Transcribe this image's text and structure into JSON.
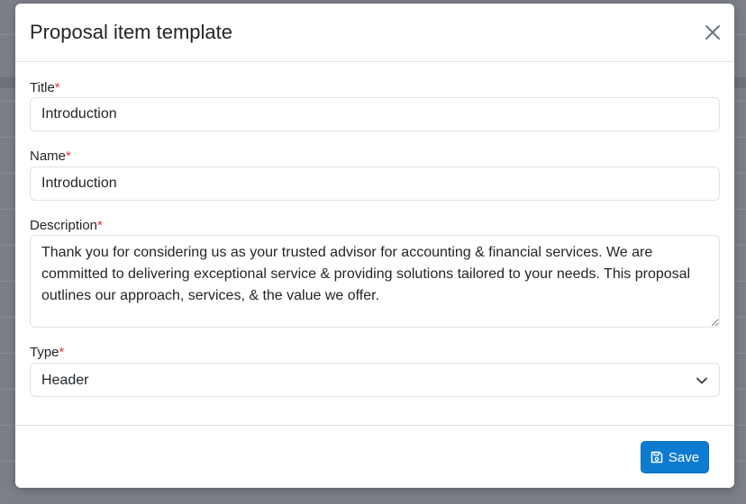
{
  "modal": {
    "title": "Proposal item template",
    "close_icon": "close-icon"
  },
  "form": {
    "title": {
      "label": "Title",
      "required_mark": "*",
      "value": "Introduction"
    },
    "name": {
      "label": "Name",
      "required_mark": "*",
      "value": "Introduction"
    },
    "description": {
      "label": "Description",
      "required_mark": "*",
      "value": "Thank you for considering us as your trusted advisor for accounting & financial services. We are committed to delivering exceptional service & providing solutions tailored to your needs. This proposal outlines our approach, services, & the value we offer."
    },
    "type": {
      "label": "Type",
      "required_mark": "*",
      "selected": "Header",
      "icon": "chevron-down-icon"
    }
  },
  "footer": {
    "save_label": "Save",
    "save_icon": "floppy-disk-icon"
  },
  "colors": {
    "primary": "#0d7bd0",
    "required": "#dc3545",
    "text": "#212529",
    "border": "#dee2e6",
    "overlay": "#7c7f86"
  }
}
